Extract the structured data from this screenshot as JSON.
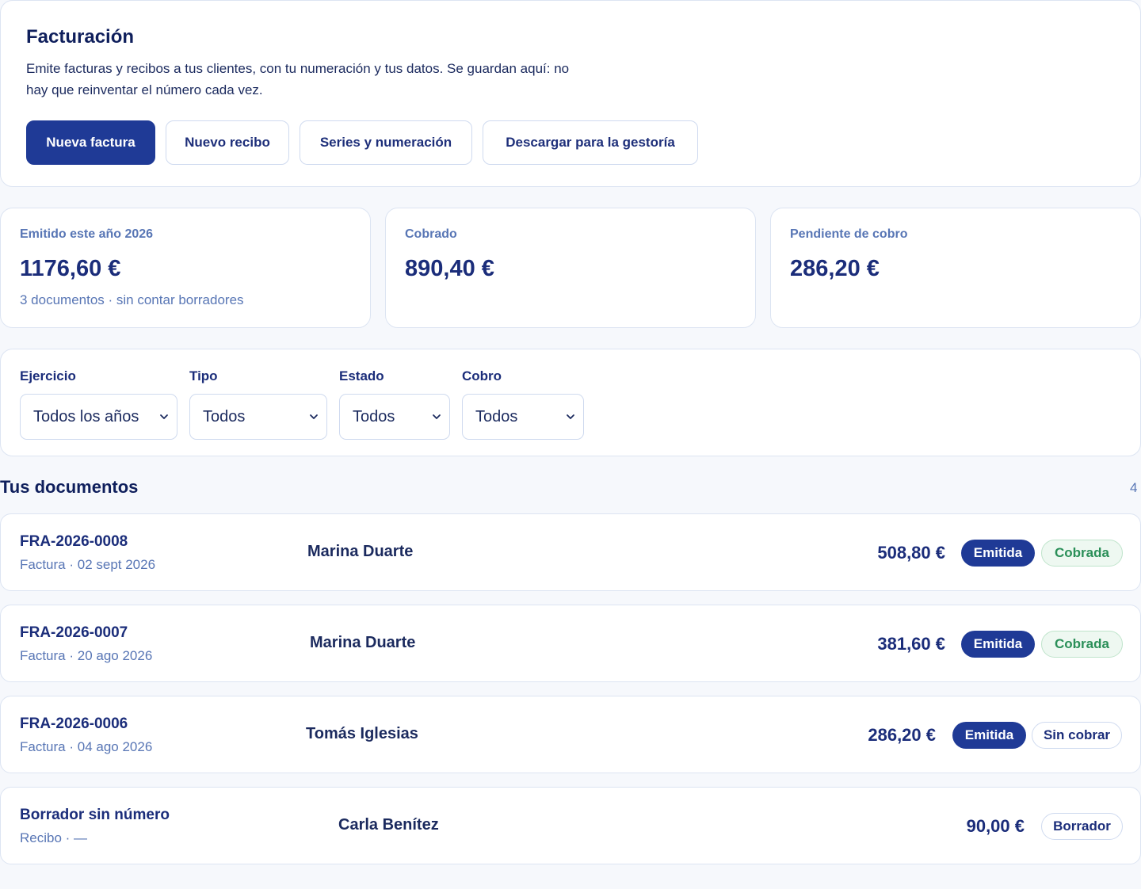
{
  "header": {
    "title": "Facturación",
    "description": "Emite facturas y recibos a tus clientes, con tu numeración y tus datos. Se guardan aquí: no hay que reinventar el número cada vez.",
    "buttons": {
      "new_invoice": "Nueva factura",
      "new_receipt": "Nuevo recibo",
      "series": "Series y numeración",
      "download": "Descargar para la gestoría"
    }
  },
  "stats": {
    "issued": {
      "label": "Emitido este año 2026",
      "value": "1176,60 €",
      "note": "3 documentos · sin contar borradores"
    },
    "collected": {
      "label": "Cobrado",
      "value": "890,40 €"
    },
    "pending": {
      "label": "Pendiente de cobro",
      "value": "286,20 €"
    }
  },
  "filters": {
    "year": {
      "label": "Ejercicio",
      "value": "Todos los años"
    },
    "type": {
      "label": "Tipo",
      "value": "Todos"
    },
    "status": {
      "label": "Estado",
      "value": "Todos"
    },
    "payment": {
      "label": "Cobro",
      "value": "Todos"
    }
  },
  "documents": {
    "title": "Tus documentos",
    "count": "4",
    "rows": [
      {
        "number": "FRA-2026-0008",
        "meta": "Factura · 02 sept 2026",
        "client": "Marina Duarte",
        "amount": "508,80 €",
        "status": "Emitida",
        "payment": "Cobrada"
      },
      {
        "number": "FRA-2026-0007",
        "meta": "Factura · 20 ago 2026",
        "client": "Marina Duarte",
        "amount": "381,60 €",
        "status": "Emitida",
        "payment": "Cobrada"
      },
      {
        "number": "FRA-2026-0006",
        "meta": "Factura · 04 ago 2026",
        "client": "Tomás Iglesias",
        "amount": "286,20 €",
        "status": "Emitida",
        "payment": "Sin cobrar"
      },
      {
        "number": "Borrador sin número",
        "meta": "Recibo · —",
        "client": "Carla Benítez",
        "amount": "90,00 €",
        "status": "Borrador"
      }
    ]
  },
  "colors": {
    "primary": "#1f3a96",
    "text": "#1b2d7a",
    "muted": "#5876b5",
    "success": "#2a8f58",
    "border": "#dce4f2"
  },
  "icons": {
    "select_chevron": "chevron-down-icon"
  }
}
